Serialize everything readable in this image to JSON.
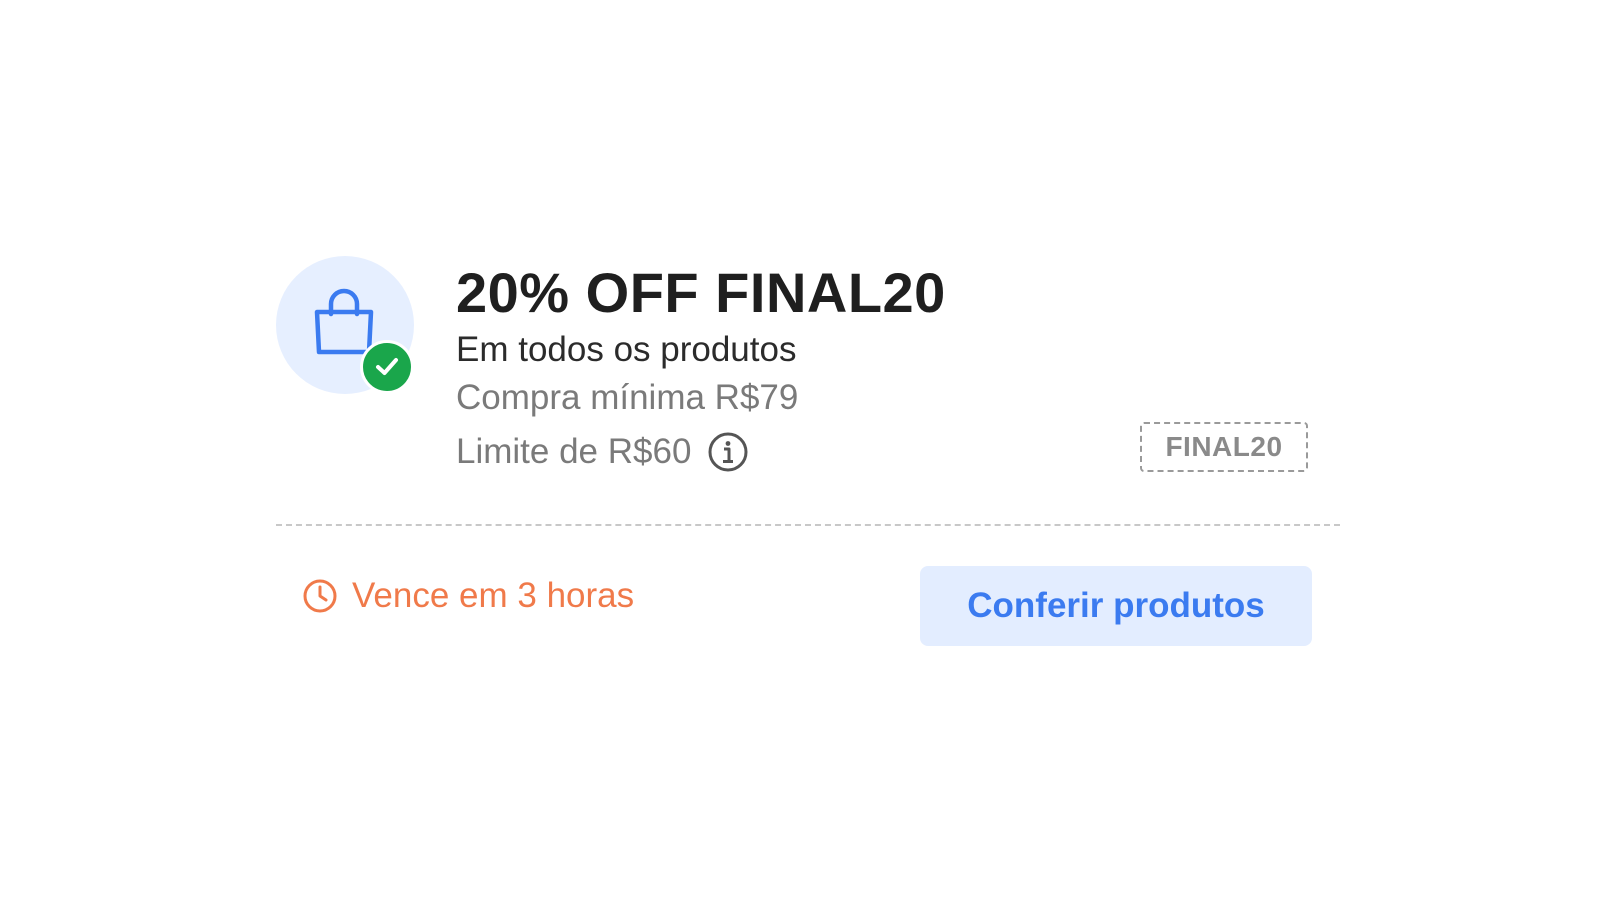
{
  "coupon": {
    "title": "20% OFF FINAL20",
    "subtitle": "Em todos os produtos",
    "min_purchase": "Compra mínima R$79",
    "limit": "Limite de R$60",
    "code": "FINAL20",
    "expiry": "Vence em 3 horas",
    "cta_label": "Conferir produtos",
    "icons": {
      "main": "shopping-bag-icon",
      "badge": "check-icon",
      "info": "info-icon",
      "expiry": "clock-icon"
    },
    "colors": {
      "title": "#1f1f1f",
      "muted": "#7a7a7a",
      "accent_blue": "#3b7bf0",
      "button_bg": "#e3edff",
      "icon_bg": "#e6efff",
      "badge_green": "#1aa64b",
      "expiry_orange": "#f07a4a"
    }
  }
}
